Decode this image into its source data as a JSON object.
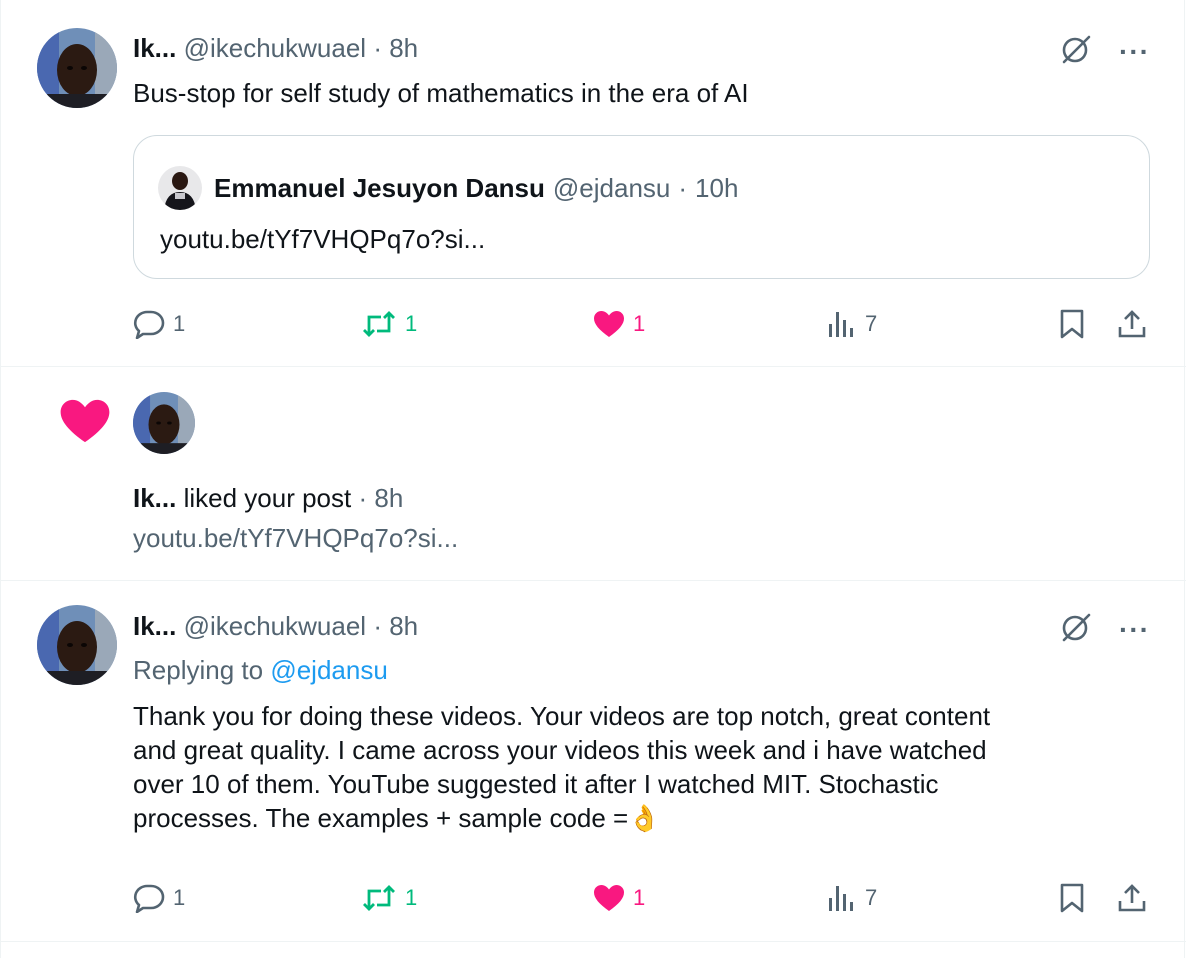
{
  "post1": {
    "author_name": "Ik...",
    "handle": "@ikechukwuael",
    "sep": "·",
    "time": "8h",
    "text": "Bus-stop for self study of mathematics in the era of AI",
    "quote": {
      "author_name": "Emmanuel Jesuyon Dansu",
      "handle": "@ejdansu",
      "time": "10h",
      "text": "youtu.be/tYf7VHQPq7o?si..."
    },
    "stats": {
      "replies": "1",
      "reposts": "1",
      "likes": "1",
      "views": "7"
    }
  },
  "notification": {
    "actor": "Ik...",
    "action": " liked your post",
    "time": "8h",
    "snippet": "youtu.be/tYf7VHQPq7o?si..."
  },
  "post2": {
    "author_name": "Ik...",
    "handle": "@ikechukwuael",
    "time": "8h",
    "replying_label": "Replying to",
    "replying_to": "@ejdansu",
    "text_lines": [
      "Thank you for doing these videos. Your videos are top notch, great content",
      "and great quality. I came across your videos this week and i have watched",
      "over 10 of them. YouTube suggested it after I watched MIT. Stochastic",
      "processes. The examples + sample code ="
    ],
    "emoji": "👌",
    "stats": {
      "replies": "1",
      "reposts": "1",
      "likes": "1",
      "views": "7"
    }
  },
  "icons": {
    "reply": "speech-bubble-icon",
    "repost": "repost-arrows-icon",
    "like": "heart-icon",
    "views": "bar-chart-icon",
    "bookmark": "bookmark-icon",
    "share": "share-upload-icon",
    "grok": "slashed-circle-icon",
    "more": "more-dots-icon"
  },
  "colors": {
    "text": "#0f1419",
    "muted": "#536471",
    "repost": "#00ba7c",
    "like": "#f91880",
    "link": "#1d9bf0",
    "border": "#eff3f4"
  }
}
